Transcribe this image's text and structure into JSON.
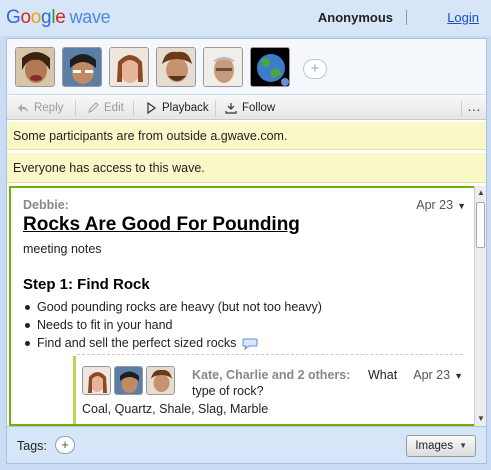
{
  "header": {
    "logo": {
      "g1": "G",
      "o1": "o",
      "o2": "o",
      "g2": "g",
      "l": "l",
      "e": "e",
      "wave": "wave"
    },
    "user": "Anonymous",
    "login": "Login"
  },
  "participants": {
    "avatars": [
      "avatar-1",
      "avatar-2",
      "avatar-3",
      "avatar-4",
      "avatar-5",
      "globe-avatar"
    ],
    "add_label": "+"
  },
  "toolbar": {
    "reply": "Reply",
    "edit": "Edit",
    "playback": "Playback",
    "follow": "Follow",
    "more": "…"
  },
  "notices": {
    "outside": "Some participants are from outside a.gwave.com.",
    "access": "Everyone has access to this wave."
  },
  "blip": {
    "author": "Debbie:",
    "date": "Apr 23",
    "title": "Rocks Are Good For Pounding",
    "subtitle": "meeting notes",
    "step": "Step 1: Find Rock",
    "bullets": [
      "Good pounding rocks are heavy (but not too heavy)",
      "Needs to fit in your hand",
      "Find and sell the perfect sized rocks"
    ]
  },
  "reply": {
    "authors": "Kate, Charlie and 2 others:",
    "text1": "What",
    "text2": "type of rock?",
    "date": "Apr 23",
    "body": "Coal, Quartz, Shale, Slag, Marble"
  },
  "footer": {
    "tags_label": "Tags:",
    "tags_add": "+",
    "images": "Images"
  },
  "colors": {
    "accent_green": "#6fb000",
    "notice_yellow": "#fbf8c8",
    "header_blue": "#d6e5f7",
    "link_blue": "#1a4fc6"
  }
}
